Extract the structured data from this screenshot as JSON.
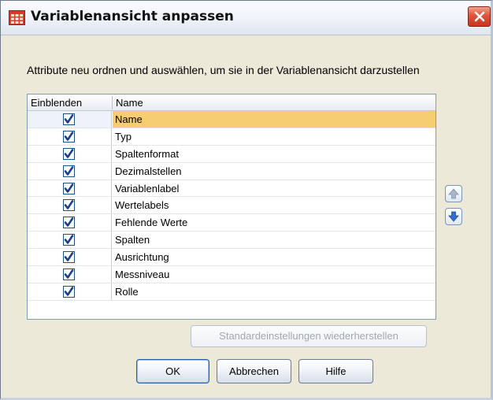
{
  "window": {
    "title": "Variablenansicht anpassen"
  },
  "instruction": "Attribute neu ordnen und auswählen, um sie in der Variablenansicht darzustellen",
  "table": {
    "headers": {
      "show": "Einblenden",
      "name": "Name"
    },
    "rows": [
      {
        "name": "Name",
        "checked": true,
        "selected": true
      },
      {
        "name": "Typ",
        "checked": true
      },
      {
        "name": "Spaltenformat",
        "checked": true
      },
      {
        "name": "Dezimalstellen",
        "checked": true
      },
      {
        "name": "Variablenlabel",
        "checked": true
      },
      {
        "name": "Wertelabels",
        "checked": true
      },
      {
        "name": "Fehlende Werte",
        "checked": true
      },
      {
        "name": "Spalten",
        "checked": true
      },
      {
        "name": "Ausrichtung",
        "checked": true
      },
      {
        "name": "Messniveau",
        "checked": true
      },
      {
        "name": "Rolle",
        "checked": true
      }
    ]
  },
  "buttons": {
    "restore": "Standardeinstellungen wiederherstellen",
    "ok": "OK",
    "cancel": "Abbrechen",
    "help": "Hilfe"
  },
  "icons": {
    "title": "table-grid-icon",
    "close": "close-icon",
    "move_up": "arrow-up-icon",
    "move_down": "arrow-down-icon",
    "check": "checkmark-icon"
  },
  "colors": {
    "selection": "#f7cd72",
    "close_button": "#d84a30",
    "check": "#1c3f8c"
  }
}
